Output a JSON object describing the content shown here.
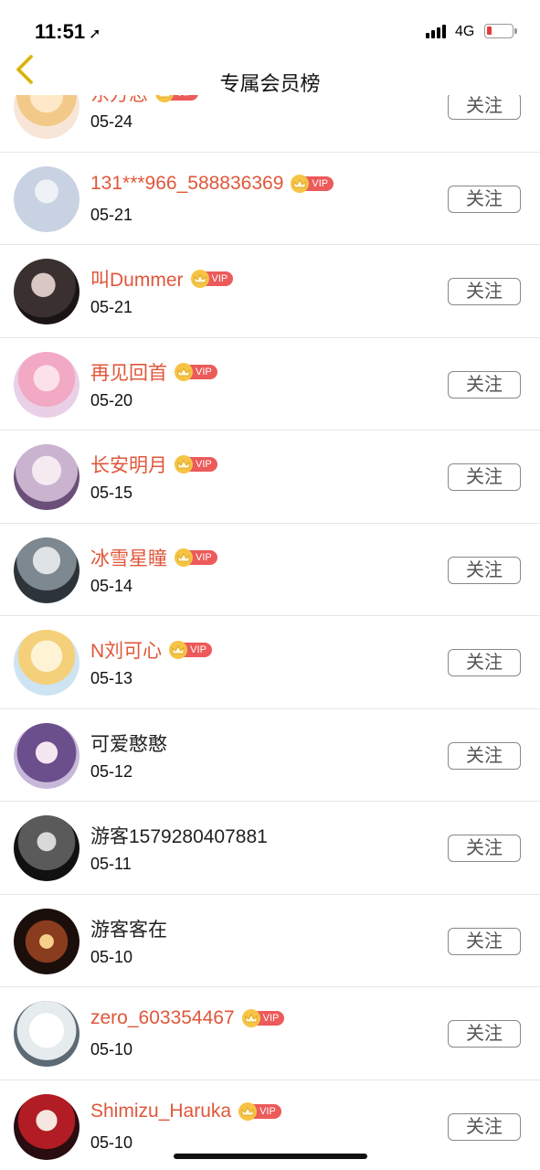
{
  "status_bar": {
    "time": "11:51",
    "network": "4G"
  },
  "nav": {
    "title": "专属会员榜"
  },
  "vip_tag_label": "VIP",
  "members": [
    {
      "name": "东方恋",
      "date": "05-24",
      "vip": true,
      "follow_label": "关注"
    },
    {
      "name": "131***966_588836369",
      "date": "05-21",
      "vip": true,
      "follow_label": "关注"
    },
    {
      "name": "叫Dummer",
      "date": "05-21",
      "vip": true,
      "follow_label": "关注"
    },
    {
      "name": "再见回首",
      "date": "05-20",
      "vip": true,
      "follow_label": "关注"
    },
    {
      "name": "长安明月",
      "date": "05-15",
      "vip": true,
      "follow_label": "关注"
    },
    {
      "name": "冰雪星瞳",
      "date": "05-14",
      "vip": true,
      "follow_label": "关注"
    },
    {
      "name": "N刘可心",
      "date": "05-13",
      "vip": true,
      "follow_label": "关注"
    },
    {
      "name": "可爱憨憨",
      "date": "05-12",
      "vip": false,
      "follow_label": "关注"
    },
    {
      "name": "游客1579280407881",
      "date": "05-11",
      "vip": false,
      "follow_label": "关注"
    },
    {
      "name": "游客客在",
      "date": "05-10",
      "vip": false,
      "follow_label": "关注"
    },
    {
      "name": "zero_603354467",
      "date": "05-10",
      "vip": true,
      "follow_label": "关注"
    },
    {
      "name": "Shimizu_Haruka",
      "date": "05-10",
      "vip": true,
      "follow_label": "关注"
    }
  ],
  "colors": {
    "vip_name": "#e0573a",
    "vip_tag": "#ec5a5a",
    "crown": "#f6c445",
    "back_arrow": "#e8c21a"
  }
}
